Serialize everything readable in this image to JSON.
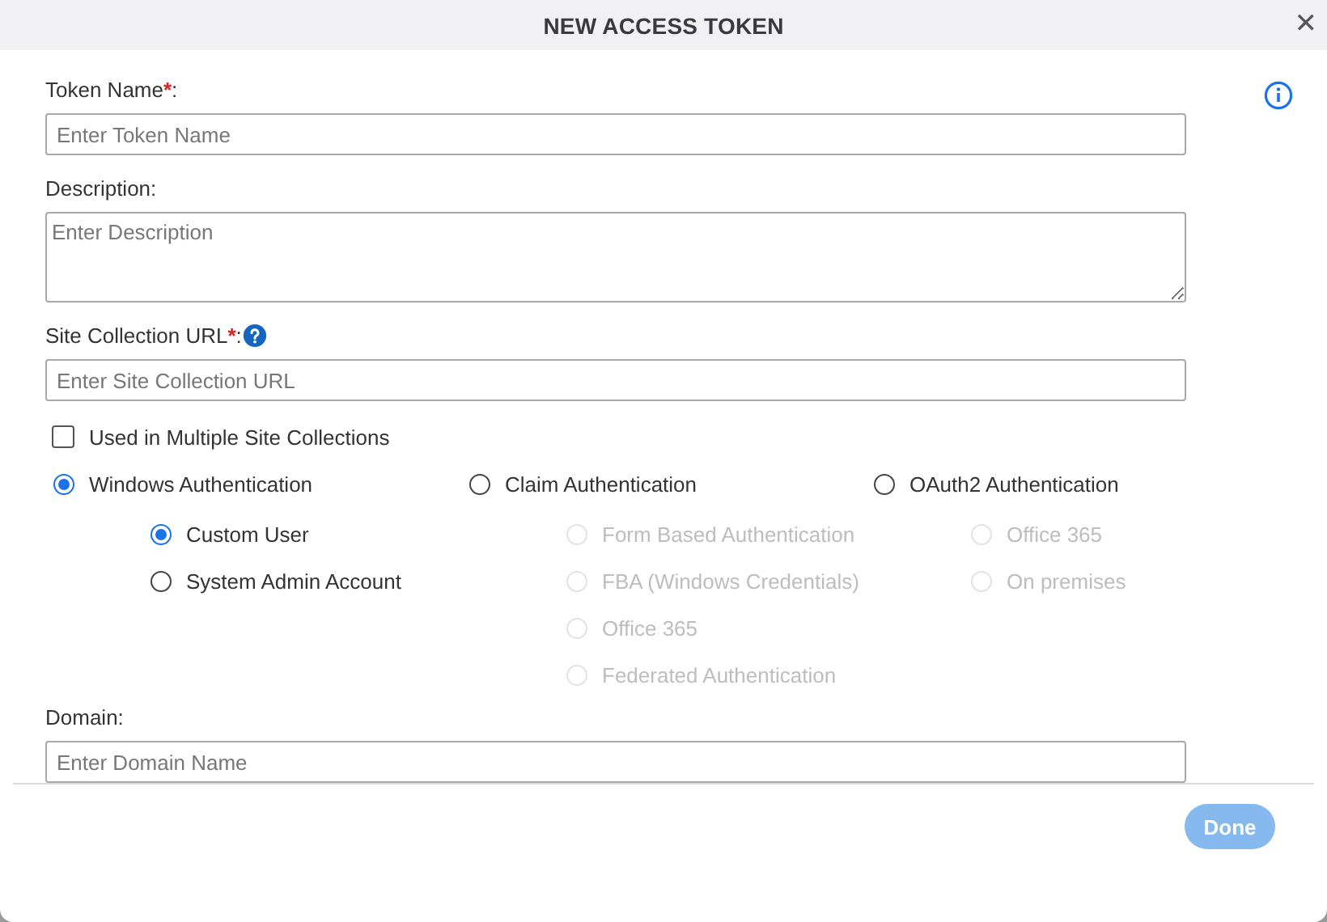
{
  "dialog": {
    "title": "NEW ACCESS TOKEN",
    "close": "✕"
  },
  "fields_top": [
    {
      "kind": "input",
      "label": "Token Name",
      "required_mark": "*",
      "label_end": ":",
      "placeholder": "Enter Token Name",
      "help": false
    },
    {
      "kind": "textarea",
      "label": "Description",
      "label_end": ":",
      "placeholder": "Enter Description",
      "help": false
    },
    {
      "kind": "input",
      "label": "Site Collection URL",
      "required_mark": "*",
      "label_end": ":",
      "placeholder": "Enter Site Collection URL",
      "help": true
    }
  ],
  "multiple_site_collections": {
    "label": "Used in Multiple Site Collections",
    "checked": false
  },
  "auth_methods": [
    {
      "label": "Windows Authentication",
      "selected": true,
      "disabled": false,
      "options": [
        {
          "label": "Custom User",
          "selected": true,
          "disabled": false
        },
        {
          "label": "System Admin Account",
          "selected": false,
          "disabled": false
        }
      ]
    },
    {
      "label": "Claim Authentication",
      "selected": false,
      "disabled": false,
      "options": [
        {
          "label": "Form Based Authentication",
          "selected": false,
          "disabled": true
        },
        {
          "label": "FBA (Windows Credentials)",
          "selected": false,
          "disabled": true
        },
        {
          "label": "Office 365",
          "selected": false,
          "disabled": true
        },
        {
          "label": "Federated Authentication",
          "selected": false,
          "disabled": true
        }
      ]
    },
    {
      "label": "OAuth2 Authentication",
      "selected": false,
      "disabled": false,
      "options": [
        {
          "label": "Office 365",
          "selected": false,
          "disabled": true
        },
        {
          "label": "On premises",
          "selected": false,
          "disabled": true
        }
      ]
    }
  ],
  "fields_bottom": [
    {
      "kind": "input",
      "label": "Domain",
      "label_end": ":",
      "placeholder": "Enter Domain Name",
      "help": false
    }
  ],
  "done_button": {
    "label": "Done",
    "disabled": true
  }
}
